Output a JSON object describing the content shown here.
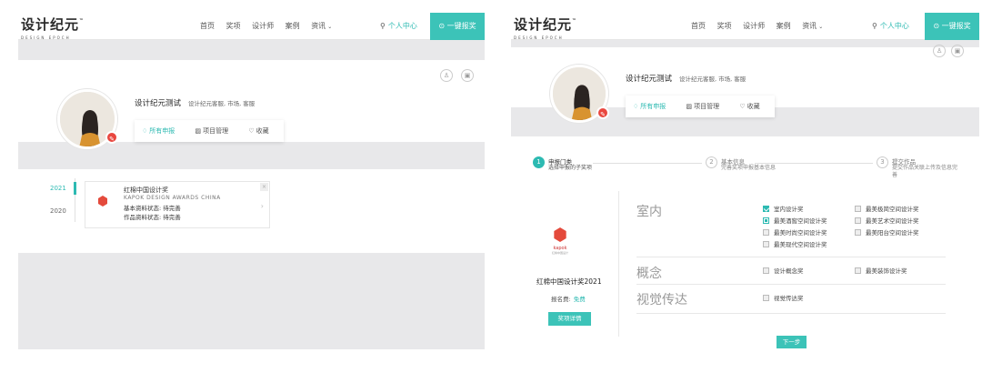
{
  "header": {
    "logo_text": "设计纪元",
    "logo_tm": "™",
    "logo_sub": "DESIGN EPOCH",
    "nav": [
      "首页",
      "奖项",
      "设计师",
      "案例",
      "资讯"
    ],
    "search_icon": "search-icon",
    "user_center": "个人中心",
    "report_button": "一键报奖"
  },
  "profile": {
    "name": "设计纪元测试",
    "tags": "设计纪元客服, 市场, 客服",
    "tabs": [
      "所有申报",
      "项目管理",
      "收藏"
    ]
  },
  "timeline": {
    "years": [
      "2021",
      "2020"
    ],
    "card": {
      "title": "红棉中国设计奖",
      "subtitle": "KAPOK DESIGN AWARDS CHINA",
      "status1": "基本资料状态: 待完善",
      "status2": "作品资料状态: 待完善"
    }
  },
  "apply": {
    "steps": [
      {
        "num": "1",
        "title": "申报门类",
        "desc": "选择申报的子奖项"
      },
      {
        "num": "2",
        "title": "基本信息",
        "desc": "完善奖项申报基本信息"
      },
      {
        "num": "3",
        "title": "提交作品",
        "desc": "提交作品关联上传及信息完善"
      }
    ],
    "award": {
      "logo_text": "kapok",
      "logo_sub": "红棉中国设计",
      "name": "红棉中国设计奖2021",
      "fee_label": "报名费:",
      "fee_value": "免费",
      "detail_button": "奖项详情"
    },
    "categories": [
      {
        "name": "室内",
        "options": [
          {
            "label": "室内设计奖",
            "state": "checked"
          },
          {
            "label": "最美极简空间设计奖",
            "state": "off"
          },
          {
            "label": "最美酒窖空间设计奖",
            "state": "partial"
          },
          {
            "label": "最美艺术空间设计奖",
            "state": "off"
          },
          {
            "label": "最美时尚空间设计奖",
            "state": "off"
          },
          {
            "label": "最美阳台空间设计奖",
            "state": "off"
          },
          {
            "label": "最美现代空间设计奖",
            "state": "off"
          }
        ]
      },
      {
        "name": "概念",
        "options": [
          {
            "label": "设计概念奖",
            "state": "off"
          },
          {
            "label": "最美装饰设计奖",
            "state": "off"
          }
        ]
      },
      {
        "name": "视觉传达",
        "options": [
          {
            "label": "视觉传达奖",
            "state": "off"
          }
        ]
      }
    ],
    "next_button": "下一步"
  },
  "colors": {
    "accent": "#3cc3b8",
    "edit": "#e9473f",
    "band": "#e8e8ea"
  }
}
